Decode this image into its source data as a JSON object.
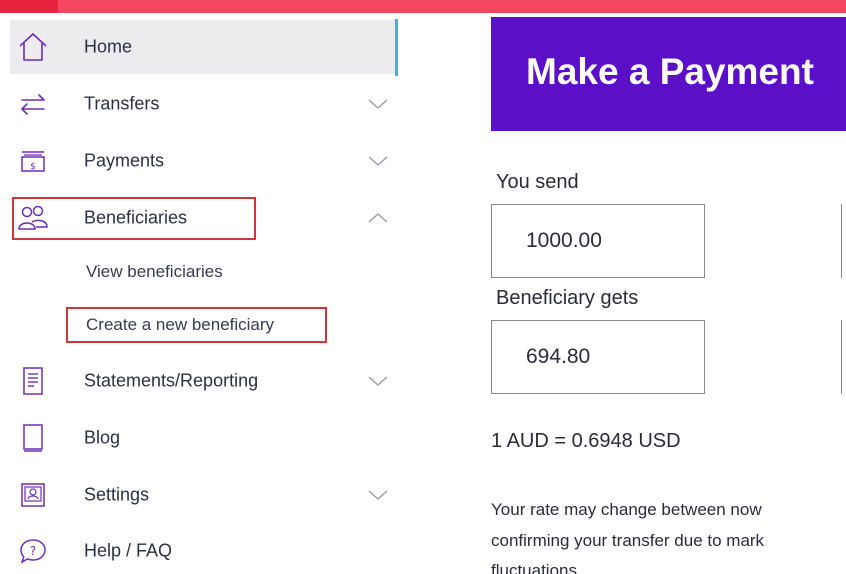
{
  "sidebar": {
    "items": [
      {
        "label": "Home",
        "icon": "home-icon",
        "active": true
      },
      {
        "label": "Transfers",
        "icon": "transfer-arrows-icon",
        "chevron": "down"
      },
      {
        "label": "Payments",
        "icon": "payment-icon",
        "chevron": "down"
      },
      {
        "label": "Beneficiaries",
        "icon": "users-icon",
        "chevron": "up"
      },
      {
        "label": "Statements/Reporting",
        "icon": "document-icon",
        "chevron": "down"
      },
      {
        "label": "Blog",
        "icon": "book-icon"
      },
      {
        "label": "Settings",
        "icon": "settings-icon",
        "chevron": "down"
      },
      {
        "label": "Help / FAQ",
        "icon": "help-icon"
      }
    ],
    "beneficiaries_subitems": [
      {
        "label": "View beneficiaries"
      },
      {
        "label": "Create a new beneficiary"
      }
    ]
  },
  "main": {
    "title": "Make a Payment",
    "you_send_label": "You send",
    "you_send_value": "1000.00",
    "beneficiary_gets_label": "Beneficiary gets",
    "beneficiary_gets_value": "694.80",
    "rate_text": "1 AUD = 0.6948 USD",
    "note_line1": "Your rate may change between now",
    "note_line2": "confirming your transfer due to mark",
    "note_line3": "fluctuations"
  },
  "colors": {
    "top_bar": "#f4475f",
    "banner": "#5b10c8",
    "highlight_box": "#d0353c",
    "active_indicator": "#59a7d9",
    "icon_purple": "#6b2fb8"
  }
}
